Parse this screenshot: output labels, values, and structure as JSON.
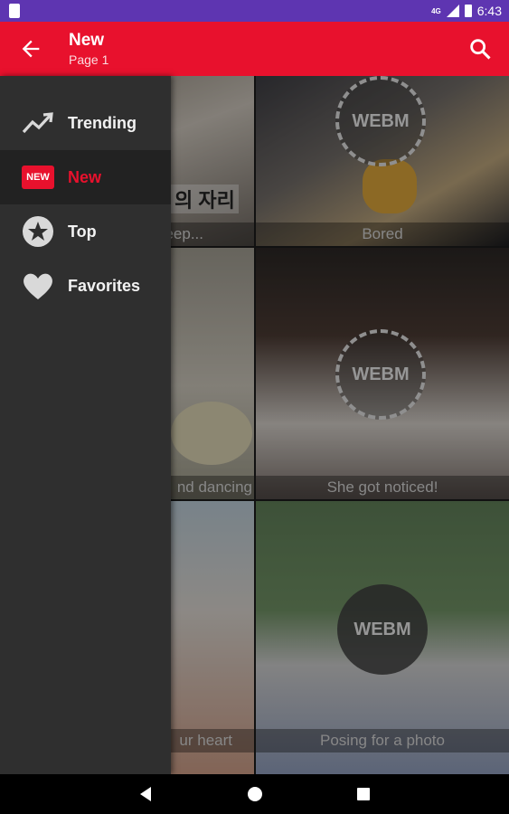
{
  "status_bar": {
    "network": "4G",
    "time": "6:43"
  },
  "app_bar": {
    "title": "New",
    "subtitle": "Page 1",
    "back_icon": "arrow-back-icon",
    "search_icon": "search-icon"
  },
  "drawer": {
    "items": [
      {
        "label": "Trending",
        "icon": "trending-up-icon",
        "active": false
      },
      {
        "label": "New",
        "icon": "new-badge-icon",
        "badge_text": "NEW",
        "active": true
      },
      {
        "label": "Top",
        "icon": "star-icon",
        "active": false
      },
      {
        "label": "Favorites",
        "icon": "heart-icon",
        "active": false
      }
    ],
    "active_color": "#e8112d"
  },
  "grid": {
    "tiles": [
      {
        "caption": "eep...",
        "webm_badge": ""
      },
      {
        "caption": "Bored",
        "webm_badge": "WEBM"
      },
      {
        "caption": "nd dancing",
        "webm_badge": ""
      },
      {
        "caption": "She got noticed!",
        "webm_badge": "WEBM"
      },
      {
        "caption": "ur heart",
        "webm_badge": ""
      },
      {
        "caption": "Posing for a photo",
        "webm_badge": "WEBM"
      }
    ],
    "korean_text": "의 자리"
  },
  "colors": {
    "status_bar": "#5e35b1",
    "app_bar": "#e8112d",
    "drawer": "#2f2f2f"
  }
}
